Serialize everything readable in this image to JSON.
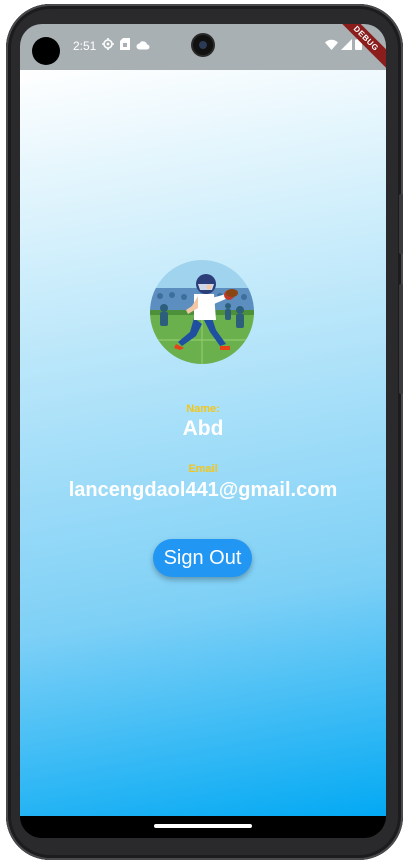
{
  "status_bar": {
    "time": "2:51",
    "left_icons": [
      "settings-icon",
      "sim-card-icon",
      "cloud-icon"
    ],
    "right_icons": [
      "wifi-icon",
      "signal-icon",
      "battery-icon"
    ],
    "debug_banner": "DEBUG"
  },
  "profile": {
    "avatar_icon": "football-player-avatar",
    "name_label": "Name:",
    "name_value": "Abd",
    "email_label": "Email",
    "email_value": "lancengdaol441@gmail.com"
  },
  "actions": {
    "sign_out_label": "Sign Out"
  },
  "colors": {
    "label_color": "#f5c518",
    "button_color": "#2196f3",
    "gradient_end": "#03a9f4"
  }
}
